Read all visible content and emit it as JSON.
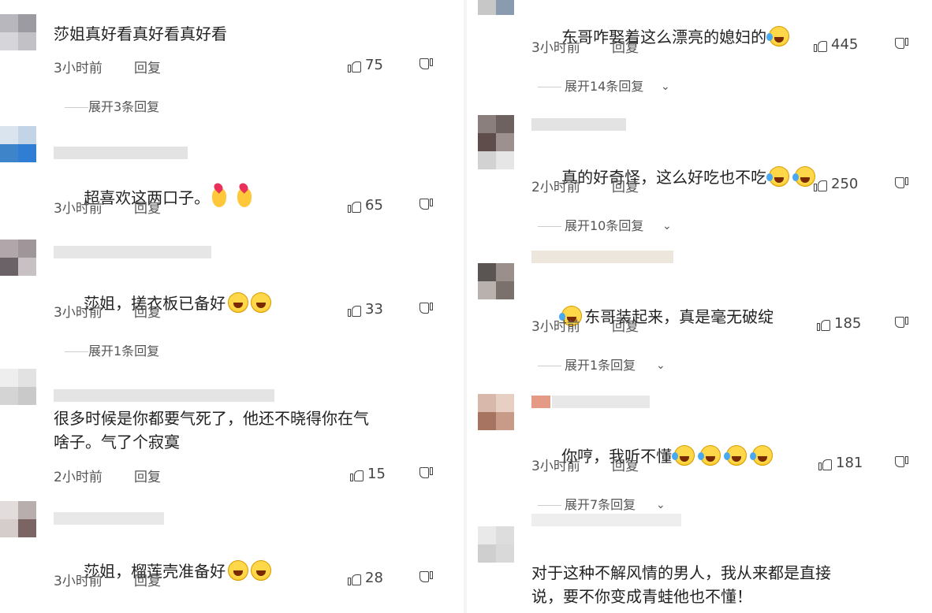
{
  "left": {
    "comments": [
      {
        "text": "莎姐真好看真好看真好看",
        "emojis": [],
        "time": "3小时前",
        "reply": "回复",
        "likes": "75"
      },
      {
        "text": "超喜欢这两口子。",
        "emojis": [
          "hand-heart-icon",
          "hand-heart-icon"
        ],
        "time": "3小时前",
        "reply": "回复",
        "likes": "65"
      },
      {
        "text": "莎姐，搓衣板已备好",
        "emojis": [
          "laugh-icon",
          "laugh-icon"
        ],
        "time": "3小时前",
        "reply": "回复",
        "likes": "33"
      },
      {
        "text": "很多时候是你都要气死了，他还不晓得你在气\n啥子。气了个寂寞",
        "emojis": [],
        "time": "2小时前",
        "reply": "回复",
        "likes": "15"
      },
      {
        "text": "莎姐，榴莲壳准备好",
        "emojis": [
          "laugh-icon",
          "laugh-icon"
        ],
        "time": "3小时前",
        "reply": "回复",
        "likes": "28"
      }
    ],
    "expands": [
      "展开3条回复",
      "展开1条回复"
    ]
  },
  "right": {
    "comments": [
      {
        "text": "东哥咋娶着这么漂亮的媳妇的",
        "emojis": [
          "tears-of-joy-icon"
        ],
        "time": "3小时前",
        "reply": "回复",
        "likes": "445"
      },
      {
        "text": "真的好奇怪，这么好吃也不吃",
        "emojis": [
          "tears-of-joy-icon",
          "tears-of-joy-icon"
        ],
        "time": "2小时前",
        "reply": "回复",
        "likes": "250"
      },
      {
        "text": "东哥装起来，真是毫无破绽",
        "emojis": [
          "tears-of-joy-icon"
        ],
        "emoji_first": true,
        "time": "3小时前",
        "reply": "回复",
        "likes": "185"
      },
      {
        "text": "你哼，我听不懂",
        "emojis": [
          "tears-of-joy-icon",
          "tears-of-joy-icon",
          "tears-of-joy-icon",
          "tears-of-joy-icon"
        ],
        "time": "3小时前",
        "reply": "回复",
        "likes": "181"
      },
      {
        "text": "对于这种不解风情的男人，我从来都是直接\n说，要不你变成青蛙他也不懂！",
        "emojis": []
      }
    ],
    "expands": [
      "展开14条回复",
      "展开10条回复",
      "展开1条回复",
      "展开7条回复"
    ]
  },
  "colors": {
    "text": "#222222",
    "meta": "#555555",
    "background": "#ffffff"
  }
}
